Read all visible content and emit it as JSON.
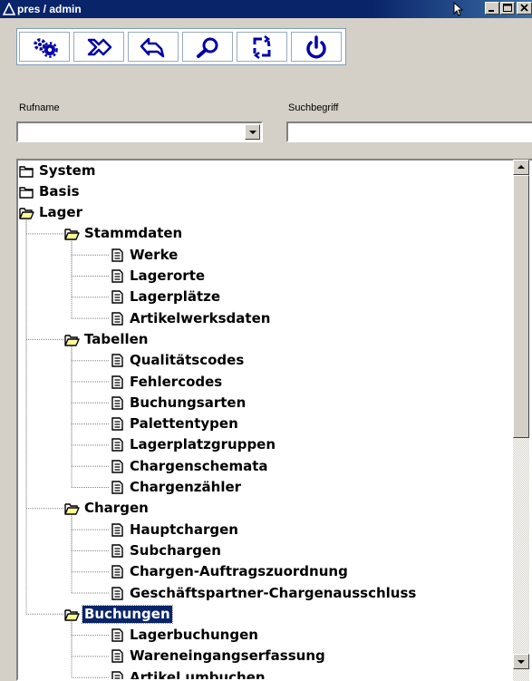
{
  "window": {
    "title": "pres / admin",
    "controls": [
      "minimize",
      "maximize",
      "close"
    ]
  },
  "toolbar": {
    "buttons": [
      {
        "icon": "gears-icon"
      },
      {
        "icon": "forward-icon"
      },
      {
        "icon": "back-icon"
      },
      {
        "icon": "search-icon"
      },
      {
        "icon": "refresh-icon"
      },
      {
        "icon": "power-icon"
      }
    ]
  },
  "form": {
    "rufname_label": "Rufname",
    "rufname_value": "",
    "suchbegriff_label": "Suchbegriff",
    "suchbegriff_value": ""
  },
  "tree": {
    "nodes": [
      {
        "label": "System",
        "type": "folder-closed",
        "level": 0
      },
      {
        "label": "Basis",
        "type": "folder-closed",
        "level": 0
      },
      {
        "label": "Lager",
        "type": "folder-open",
        "level": 0
      },
      {
        "label": "Stammdaten",
        "type": "folder-open",
        "level": 1
      },
      {
        "label": "Werke",
        "type": "document",
        "level": 2
      },
      {
        "label": "Lagerorte",
        "type": "document",
        "level": 2
      },
      {
        "label": "Lagerplätze",
        "type": "document",
        "level": 2
      },
      {
        "label": "Artikelwerksdaten",
        "type": "document",
        "level": 2
      },
      {
        "label": "Tabellen",
        "type": "folder-open",
        "level": 1
      },
      {
        "label": "Qualitätscodes",
        "type": "document",
        "level": 2
      },
      {
        "label": "Fehlercodes",
        "type": "document",
        "level": 2
      },
      {
        "label": "Buchungsarten",
        "type": "document",
        "level": 2
      },
      {
        "label": "Palettentypen",
        "type": "document",
        "level": 2
      },
      {
        "label": "Lagerplatzgruppen",
        "type": "document",
        "level": 2
      },
      {
        "label": "Chargenschemata",
        "type": "document",
        "level": 2
      },
      {
        "label": "Chargenzähler",
        "type": "document",
        "level": 2
      },
      {
        "label": "Chargen",
        "type": "folder-open",
        "level": 1
      },
      {
        "label": "Hauptchargen",
        "type": "document",
        "level": 2
      },
      {
        "label": "Subchargen",
        "type": "document",
        "level": 2
      },
      {
        "label": "Chargen-Auftragszuordnung",
        "type": "document",
        "level": 2
      },
      {
        "label": "Geschäftspartner-Chargenausschluss",
        "type": "document",
        "level": 2
      },
      {
        "label": "Buchungen",
        "type": "folder-open",
        "level": 1,
        "selected": true
      },
      {
        "label": "Lagerbuchungen",
        "type": "document",
        "level": 2
      },
      {
        "label": "Wareneingangserfassung",
        "type": "document",
        "level": 2
      },
      {
        "label": "Artikel umbuchen",
        "type": "document",
        "level": 2
      }
    ]
  },
  "colors": {
    "titlebar": "#0a246a",
    "face": "#d4d0c8",
    "selection": "#0a246a",
    "tree_lines": "#808080"
  }
}
